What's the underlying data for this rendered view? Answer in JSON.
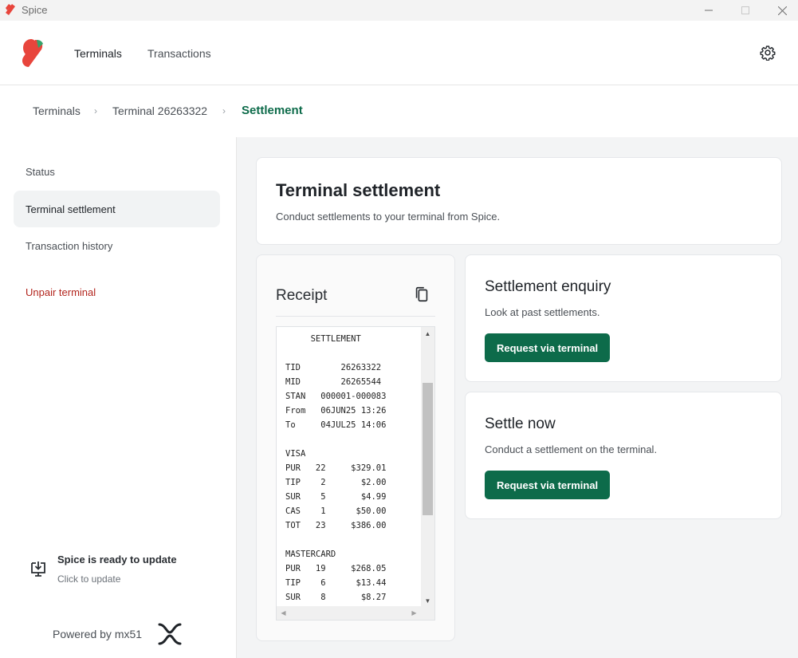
{
  "window": {
    "title": "Spice"
  },
  "topnav": {
    "items": [
      {
        "label": "Terminals",
        "active": true
      },
      {
        "label": "Transactions",
        "active": false
      }
    ],
    "settings_icon": "gear-icon"
  },
  "breadcrumb": {
    "items": [
      "Terminals",
      "Terminal 26263322",
      "Settlement"
    ],
    "separator": "›"
  },
  "sidebar": {
    "items": [
      {
        "label": "Status",
        "selected": false
      },
      {
        "label": "Terminal settlement",
        "selected": true
      },
      {
        "label": "Transaction history",
        "selected": false
      }
    ],
    "unpair_label": "Unpair terminal",
    "update": {
      "title": "Spice is ready to update",
      "subtitle": "Click to update",
      "icon": "download-monitor-icon"
    },
    "powered_by": "Powered by mx51"
  },
  "header_card": {
    "title": "Terminal settlement",
    "subtitle": "Conduct settlements to your terminal from Spice."
  },
  "receipt": {
    "title": "Receipt",
    "copy_icon": "copy-icon",
    "lines": [
      "     SETTLEMENT",
      "",
      "TID        26263322",
      "MID        26265544",
      "STAN   000001-000083",
      "From   06JUN25 13:26",
      "To     04JUL25 14:06",
      "",
      "VISA",
      "PUR   22     $329.01",
      "TIP    2       $2.00",
      "SUR    5       $4.99",
      "CAS    1      $50.00",
      "TOT   23     $386.00",
      "",
      "MASTERCARD",
      "PUR   19     $268.05",
      "TIP    6      $13.44",
      "SUR    8       $8.27"
    ]
  },
  "enquiry_card": {
    "title": "Settlement enquiry",
    "subtitle": "Look at past settlements.",
    "button_label": "Request via terminal"
  },
  "settle_card": {
    "title": "Settle now",
    "subtitle": "Conduct a settlement on the terminal.",
    "button_label": "Request via terminal"
  },
  "colors": {
    "primary": "#0d6b4a",
    "danger": "#b3261e",
    "background": "#f3f4f5",
    "logo_red": "#e8453c",
    "logo_green": "#35a36b"
  }
}
